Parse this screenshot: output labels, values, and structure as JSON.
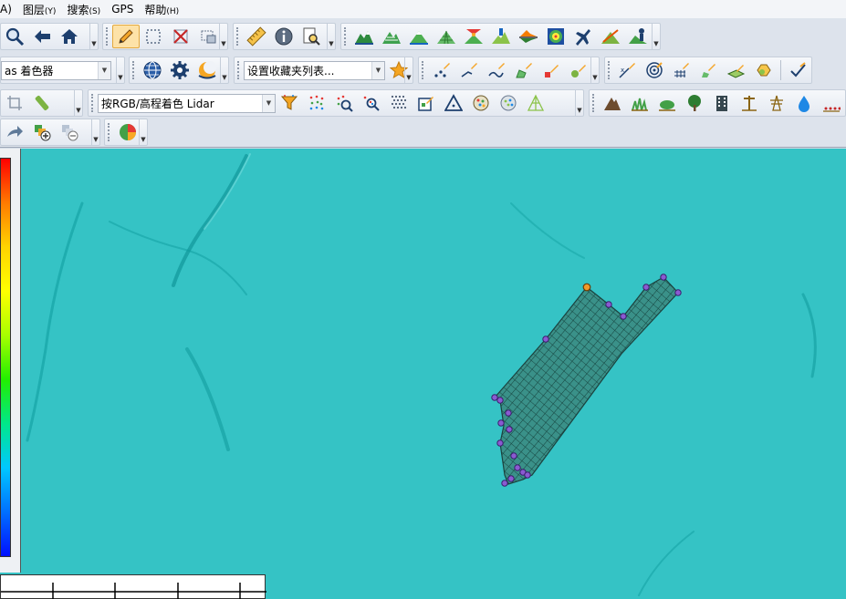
{
  "menu": [
    {
      "label": "A)"
    },
    {
      "label": "图层",
      "key": "(Y)"
    },
    {
      "label": "搜索",
      "key": "(S)"
    },
    {
      "label": "GPS",
      "key": ""
    },
    {
      "label": "帮助",
      "key": "(H)"
    }
  ],
  "toolbars": {
    "color_mode_combo": "as 着色器",
    "favorites_combo": "设置收藏夹列表...",
    "lidar_combo": "按RGB/高程着色 Lidar"
  },
  "icons": {
    "row1": [
      "zoom-icon",
      "back-arrow-icon",
      "home-icon",
      "edit-pencil-icon",
      "select-rectangle-icon",
      "delete-x-icon",
      "select-overlay-icon",
      "measure-ruler-icon",
      "info-icon",
      "search-doc-icon",
      "terrain-profile-icon",
      "terrain-contour-icon",
      "terrain-green-icon",
      "terrain-grid-icon",
      "view-shed-icon",
      "terrain-volume-icon",
      "cut-fill-icon",
      "elevation-map-icon",
      "flight-icon",
      "terrain-path-icon",
      "terrain-person-icon"
    ],
    "row2": [
      "globe-icon",
      "gear-icon",
      "moon-icon",
      "star-icon",
      "digitize-points-icon",
      "digitize-line-icon",
      "digitize-curve-icon",
      "digitize-area-icon",
      "digitize-edit-icon",
      "digitize-node-icon",
      "coord-point-icon",
      "target-icon",
      "grid-pencil-icon",
      "area-pencil-icon",
      "map-pencil-icon",
      "shape-icon",
      "check-icon"
    ],
    "row3": [
      "crop-icon",
      "slice-icon",
      "funnel-filter-icon",
      "point-cloud-icon",
      "point-select-icon",
      "point-search-icon",
      "point-grid-icon",
      "point-edit-icon",
      "triangle-icon",
      "classify-icon",
      "classify-2-icon",
      "tin-icon",
      "ground-icon",
      "grass-icon",
      "shrub-icon",
      "tree-icon",
      "building-icon",
      "power-pole-icon",
      "tower-icon",
      "water-icon",
      "noise-icon"
    ],
    "row4": [
      "forward-arrow-icon",
      "add-layer-icon",
      "remove-layer-icon",
      "pie-chart-icon"
    ]
  },
  "colors": {
    "terrain": "#1fb4b6",
    "selection_grid": "#2a5a50",
    "vertex": "#6a3fb0",
    "active_tool": "#fde2a8"
  }
}
